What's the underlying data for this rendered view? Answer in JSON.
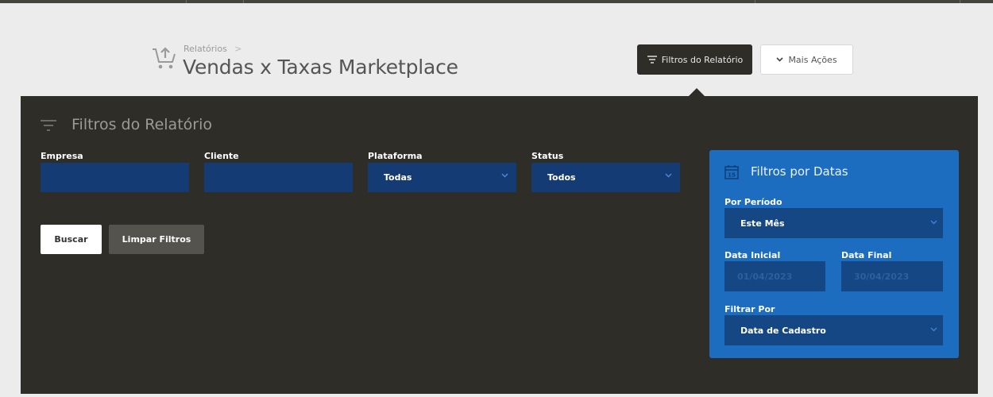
{
  "header": {
    "breadcrumb": "Relatórios",
    "breadcrumb_separator": ">",
    "title": "Vendas x Taxas Marketplace",
    "filtros_button_label": "Filtros do Relatório",
    "mais_acoes_label": "Mais Ações"
  },
  "panel": {
    "title": "Filtros do Relatório",
    "fields": {
      "empresa": {
        "label": "Empresa",
        "value": ""
      },
      "cliente": {
        "label": "Cliente",
        "value": ""
      },
      "plataforma": {
        "label": "Plataforma",
        "value": "Todas"
      },
      "status": {
        "label": "Status",
        "value": "Todos"
      }
    },
    "buscar_label": "Buscar",
    "limpar_label": "Limpar Filtros"
  },
  "date_filter": {
    "title": "Filtros por Datas",
    "calendar_icon_day": "15",
    "periodo": {
      "label": "Por Período",
      "value": "Este Mês"
    },
    "data_inicial": {
      "label": "Data Inicial",
      "value": "01/04/2023"
    },
    "data_final": {
      "label": "Data Final",
      "value": "30/04/2023"
    },
    "filtrar_por": {
      "label": "Filtrar Por",
      "value": "Data de Cadastro"
    }
  },
  "colors": {
    "page_bg": "#ececec",
    "panel_bg": "#2f2d28",
    "field_bg": "#143b73",
    "card_bg": "#1c6cc0"
  }
}
